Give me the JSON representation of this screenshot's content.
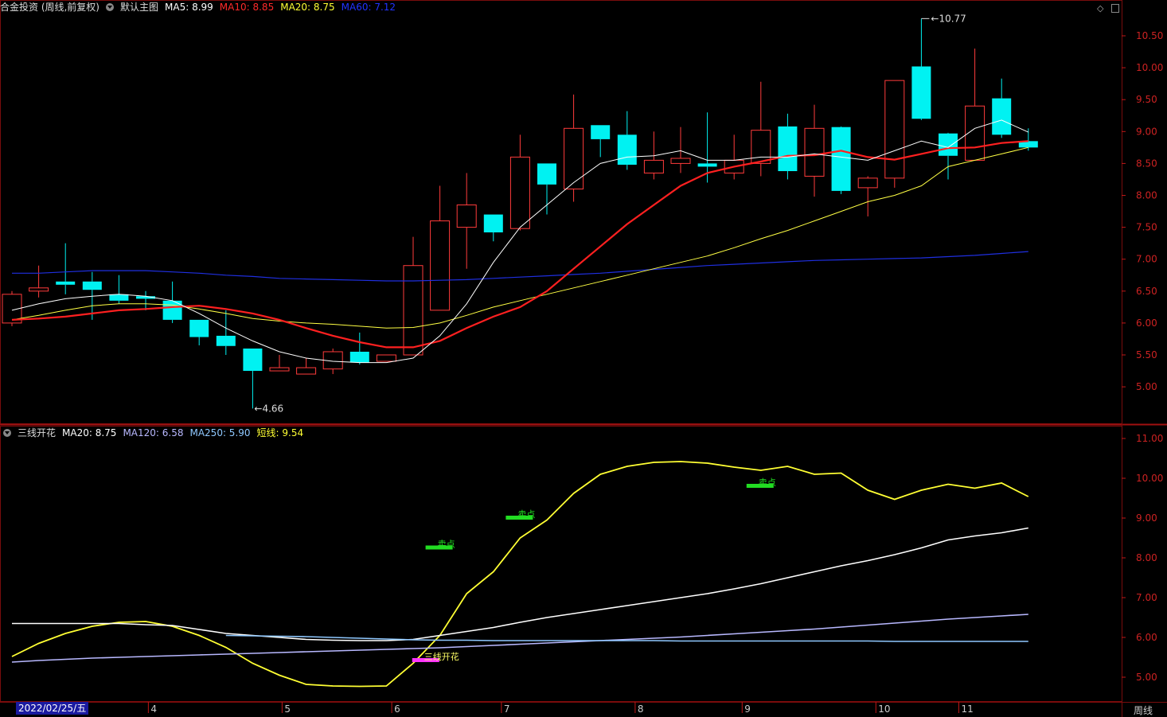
{
  "main": {
    "title": "合金投资 (周线,前复权)",
    "subtitle": "默认主图",
    "ma_labels": [
      {
        "text": "MA5: 8.99",
        "color": "#ffffff"
      },
      {
        "text": "MA10: 8.85",
        "color": "#ff2a2a"
      },
      {
        "text": "MA20: 8.75",
        "color": "#ffff33"
      },
      {
        "text": "MA60: 7.12",
        "color": "#2233ff"
      }
    ],
    "price_ticks": [
      "10.50",
      "10.00",
      "9.50",
      "9.00",
      "8.50",
      "8.00",
      "7.50",
      "7.00",
      "6.50",
      "6.00",
      "5.50",
      "5.00"
    ],
    "high_label": "10.77",
    "low_label": "4.66"
  },
  "sub": {
    "title": "三线开花",
    "ma_labels": [
      {
        "text": "MA20: 8.75",
        "color": "#ffffff"
      },
      {
        "text": "MA120: 6.58",
        "color": "#b8b8ff"
      },
      {
        "text": "MA250: 5.90",
        "color": "#8fc8ff"
      },
      {
        "text": "短线: 9.54",
        "color": "#ffff33"
      }
    ],
    "ticks": [
      "11.00",
      "10.00",
      "9.00",
      "8.00",
      "7.00",
      "6.00",
      "5.00"
    ],
    "signals": [
      {
        "label": "卖点",
        "color": "#22dd22",
        "x_index": 16,
        "value": 8.25
      },
      {
        "label": "卖点",
        "color": "#22dd22",
        "x_index": 19,
        "value": 9.0
      },
      {
        "label": "卖点",
        "color": "#22dd22",
        "x_index": 28,
        "value": 9.8
      },
      {
        "label": "三线开花",
        "color": "#ff33ff",
        "x_index": 15.5,
        "value": 5.42
      }
    ]
  },
  "xaxis": {
    "date": "2022/02/25/五",
    "months": [
      {
        "label": "4",
        "index": 5.1
      },
      {
        "label": "5",
        "index": 10.1
      },
      {
        "label": "6",
        "index": 14.2
      },
      {
        "label": "7",
        "index": 18.3
      },
      {
        "label": "8",
        "index": 23.3
      },
      {
        "label": "9",
        "index": 27.3
      },
      {
        "label": "10",
        "index": 32.3
      },
      {
        "label": "11",
        "index": 35.4
      }
    ],
    "period": "周线"
  },
  "colors": {
    "up": "#ff3b3b",
    "down": "#00f2f2",
    "grid": "#7a0c0c",
    "ma5": "#ffffff",
    "ma10": "#ff2020",
    "ma20": "#ffff44",
    "ma60": "#1f2fe0",
    "short_line": "#ffff33"
  },
  "chart_data": [
    {
      "type": "candlestick",
      "title": "合金投资 (周线,前复权)",
      "ylim": [
        4.6,
        10.8
      ],
      "candles": [
        {
          "o": 6.0,
          "c": 6.45,
          "h": 6.5,
          "l": 5.95
        },
        {
          "o": 6.5,
          "c": 6.55,
          "h": 6.9,
          "l": 6.4
        },
        {
          "o": 6.65,
          "c": 6.6,
          "h": 7.25,
          "l": 6.45
        },
        {
          "o": 6.65,
          "c": 6.52,
          "h": 6.8,
          "l": 6.05
        },
        {
          "o": 6.45,
          "c": 6.35,
          "h": 6.75,
          "l": 6.3
        },
        {
          "o": 6.42,
          "c": 6.38,
          "h": 6.5,
          "l": 6.2
        },
        {
          "o": 6.35,
          "c": 6.05,
          "h": 6.65,
          "l": 6.0
        },
        {
          "o": 6.05,
          "c": 5.78,
          "h": 6.05,
          "l": 5.65
        },
        {
          "o": 5.8,
          "c": 5.64,
          "h": 6.2,
          "l": 5.5
        },
        {
          "o": 5.6,
          "c": 5.25,
          "h": 5.6,
          "l": 4.66
        },
        {
          "o": 5.25,
          "c": 5.3,
          "h": 5.5,
          "l": 5.25
        },
        {
          "o": 5.2,
          "c": 5.3,
          "h": 5.45,
          "l": 5.2
        },
        {
          "o": 5.28,
          "c": 5.55,
          "h": 5.6,
          "l": 5.2
        },
        {
          "o": 5.55,
          "c": 5.38,
          "h": 5.85,
          "l": 5.35
        },
        {
          "o": 5.4,
          "c": 5.5,
          "h": 5.5,
          "l": 5.4
        },
        {
          "o": 5.5,
          "c": 6.9,
          "h": 7.35,
          "l": 5.5
        },
        {
          "o": 6.2,
          "c": 7.6,
          "h": 8.15,
          "l": 6.2
        },
        {
          "o": 7.5,
          "c": 7.85,
          "h": 8.35,
          "l": 6.85
        },
        {
          "o": 7.7,
          "c": 7.42,
          "h": 7.7,
          "l": 7.28
        },
        {
          "o": 7.48,
          "c": 8.6,
          "h": 8.95,
          "l": 7.45
        },
        {
          "o": 8.5,
          "c": 8.17,
          "h": 8.5,
          "l": 7.7
        },
        {
          "o": 8.1,
          "c": 9.05,
          "h": 9.58,
          "l": 7.9
        },
        {
          "o": 9.1,
          "c": 8.88,
          "h": 9.1,
          "l": 8.6
        },
        {
          "o": 8.95,
          "c": 8.48,
          "h": 9.32,
          "l": 8.4
        },
        {
          "o": 8.35,
          "c": 8.55,
          "h": 9.0,
          "l": 8.25
        },
        {
          "o": 8.5,
          "c": 8.58,
          "h": 9.07,
          "l": 8.35
        },
        {
          "o": 8.5,
          "c": 8.45,
          "h": 9.3,
          "l": 8.2
        },
        {
          "o": 8.35,
          "c": 8.55,
          "h": 8.95,
          "l": 8.25
        },
        {
          "o": 8.5,
          "c": 9.02,
          "h": 9.78,
          "l": 8.3
        },
        {
          "o": 9.08,
          "c": 8.38,
          "h": 9.28,
          "l": 8.25
        },
        {
          "o": 8.3,
          "c": 9.05,
          "h": 9.42,
          "l": 7.98
        },
        {
          "o": 9.07,
          "c": 8.07,
          "h": 9.08,
          "l": 8.02
        },
        {
          "o": 8.12,
          "c": 8.27,
          "h": 8.3,
          "l": 7.67
        },
        {
          "o": 8.27,
          "c": 9.8,
          "h": 9.8,
          "l": 8.12
        },
        {
          "o": 10.02,
          "c": 9.2,
          "h": 10.77,
          "l": 9.18
        },
        {
          "o": 8.97,
          "c": 8.62,
          "h": 8.98,
          "l": 8.25
        },
        {
          "o": 8.55,
          "c": 9.4,
          "h": 10.3,
          "l": 8.55
        },
        {
          "o": 9.52,
          "c": 8.95,
          "h": 9.83,
          "l": 8.9
        },
        {
          "o": 8.85,
          "c": 8.75,
          "h": 9.05,
          "l": 8.7
        }
      ],
      "ma5": [
        6.2,
        6.3,
        6.38,
        6.42,
        6.45,
        6.42,
        6.35,
        6.15,
        5.92,
        5.72,
        5.55,
        5.45,
        5.4,
        5.38,
        5.38,
        5.45,
        5.8,
        6.3,
        6.95,
        7.5,
        7.85,
        8.2,
        8.5,
        8.6,
        8.62,
        8.7,
        8.55,
        8.55,
        8.6,
        8.6,
        8.65,
        8.6,
        8.55,
        8.7,
        8.85,
        8.75,
        9.05,
        9.18,
        8.99
      ],
      "ma10": [
        6.05,
        6.07,
        6.1,
        6.15,
        6.2,
        6.22,
        6.25,
        6.27,
        6.22,
        6.15,
        6.05,
        5.92,
        5.8,
        5.7,
        5.62,
        5.62,
        5.72,
        5.92,
        6.1,
        6.25,
        6.5,
        6.85,
        7.2,
        7.55,
        7.85,
        8.15,
        8.35,
        8.45,
        8.53,
        8.62,
        8.63,
        8.7,
        8.6,
        8.56,
        8.65,
        8.74,
        8.75,
        8.82,
        8.85
      ],
      "ma20": [
        6.05,
        6.12,
        6.2,
        6.27,
        6.3,
        6.3,
        6.28,
        6.22,
        6.15,
        6.07,
        6.03,
        6.0,
        5.98,
        5.95,
        5.92,
        5.93,
        6.0,
        6.12,
        6.25,
        6.35,
        6.45,
        6.55,
        6.65,
        6.75,
        6.85,
        6.95,
        7.05,
        7.18,
        7.32,
        7.45,
        7.6,
        7.75,
        7.9,
        8.0,
        8.15,
        8.45,
        8.55,
        8.65,
        8.75
      ],
      "ma60": [
        6.78,
        6.78,
        6.8,
        6.82,
        6.82,
        6.82,
        6.8,
        6.78,
        6.75,
        6.73,
        6.7,
        6.69,
        6.68,
        6.67,
        6.66,
        6.66,
        6.67,
        6.68,
        6.7,
        6.72,
        6.74,
        6.76,
        6.78,
        6.81,
        6.84,
        6.87,
        6.9,
        6.92,
        6.94,
        6.96,
        6.98,
        6.99,
        7.0,
        7.01,
        7.02,
        7.04,
        7.06,
        7.09,
        7.12
      ]
    },
    {
      "type": "line",
      "title": "三线开花",
      "ylim": [
        4.6,
        11.3
      ],
      "series": [
        {
          "name": "短线",
          "color": "#ffff33",
          "values": [
            5.52,
            5.85,
            6.1,
            6.28,
            6.38,
            6.4,
            6.28,
            6.05,
            5.75,
            5.35,
            5.05,
            4.82,
            4.78,
            4.77,
            4.78,
            5.35,
            6.05,
            7.1,
            7.65,
            8.5,
            8.95,
            9.62,
            10.1,
            10.3,
            10.4,
            10.42,
            10.38,
            10.28,
            10.2,
            10.3,
            10.1,
            10.13,
            9.7,
            9.47,
            9.7,
            9.85,
            9.75,
            9.88,
            9.54
          ]
        },
        {
          "name": "MA20",
          "color": "#ffffff",
          "values": [
            6.35,
            6.35,
            6.35,
            6.35,
            6.35,
            6.32,
            6.3,
            6.2,
            6.1,
            6.05,
            6.0,
            5.95,
            5.93,
            5.92,
            5.92,
            5.95,
            6.05,
            6.15,
            6.25,
            6.38,
            6.5,
            6.6,
            6.7,
            6.8,
            6.9,
            7.0,
            7.1,
            7.22,
            7.35,
            7.5,
            7.65,
            7.8,
            7.93,
            8.08,
            8.25,
            8.45,
            8.55,
            8.63,
            8.75
          ]
        },
        {
          "name": "MA120",
          "color": "#b8b8ff",
          "values": [
            5.38,
            5.42,
            5.45,
            5.48,
            5.5,
            5.52,
            5.54,
            5.56,
            5.58,
            5.6,
            5.62,
            5.64,
            5.66,
            5.68,
            5.7,
            5.72,
            5.74,
            5.77,
            5.8,
            5.83,
            5.86,
            5.89,
            5.92,
            5.95,
            5.98,
            6.01,
            6.05,
            6.09,
            6.13,
            6.17,
            6.21,
            6.26,
            6.31,
            6.36,
            6.41,
            6.46,
            6.5,
            6.54,
            6.58
          ]
        },
        {
          "name": "MA250",
          "color": "#8fc8ff",
          "values": [
            null,
            null,
            null,
            null,
            null,
            null,
            null,
            null,
            6.05,
            6.04,
            6.03,
            6.02,
            6.0,
            5.98,
            5.96,
            5.94,
            5.93,
            5.93,
            5.92,
            5.92,
            5.92,
            5.92,
            5.92,
            5.92,
            5.92,
            5.91,
            5.91,
            5.91,
            5.91,
            5.91,
            5.91,
            5.91,
            5.91,
            5.9,
            5.9,
            5.9,
            5.9,
            5.9,
            5.9
          ]
        }
      ]
    }
  ]
}
